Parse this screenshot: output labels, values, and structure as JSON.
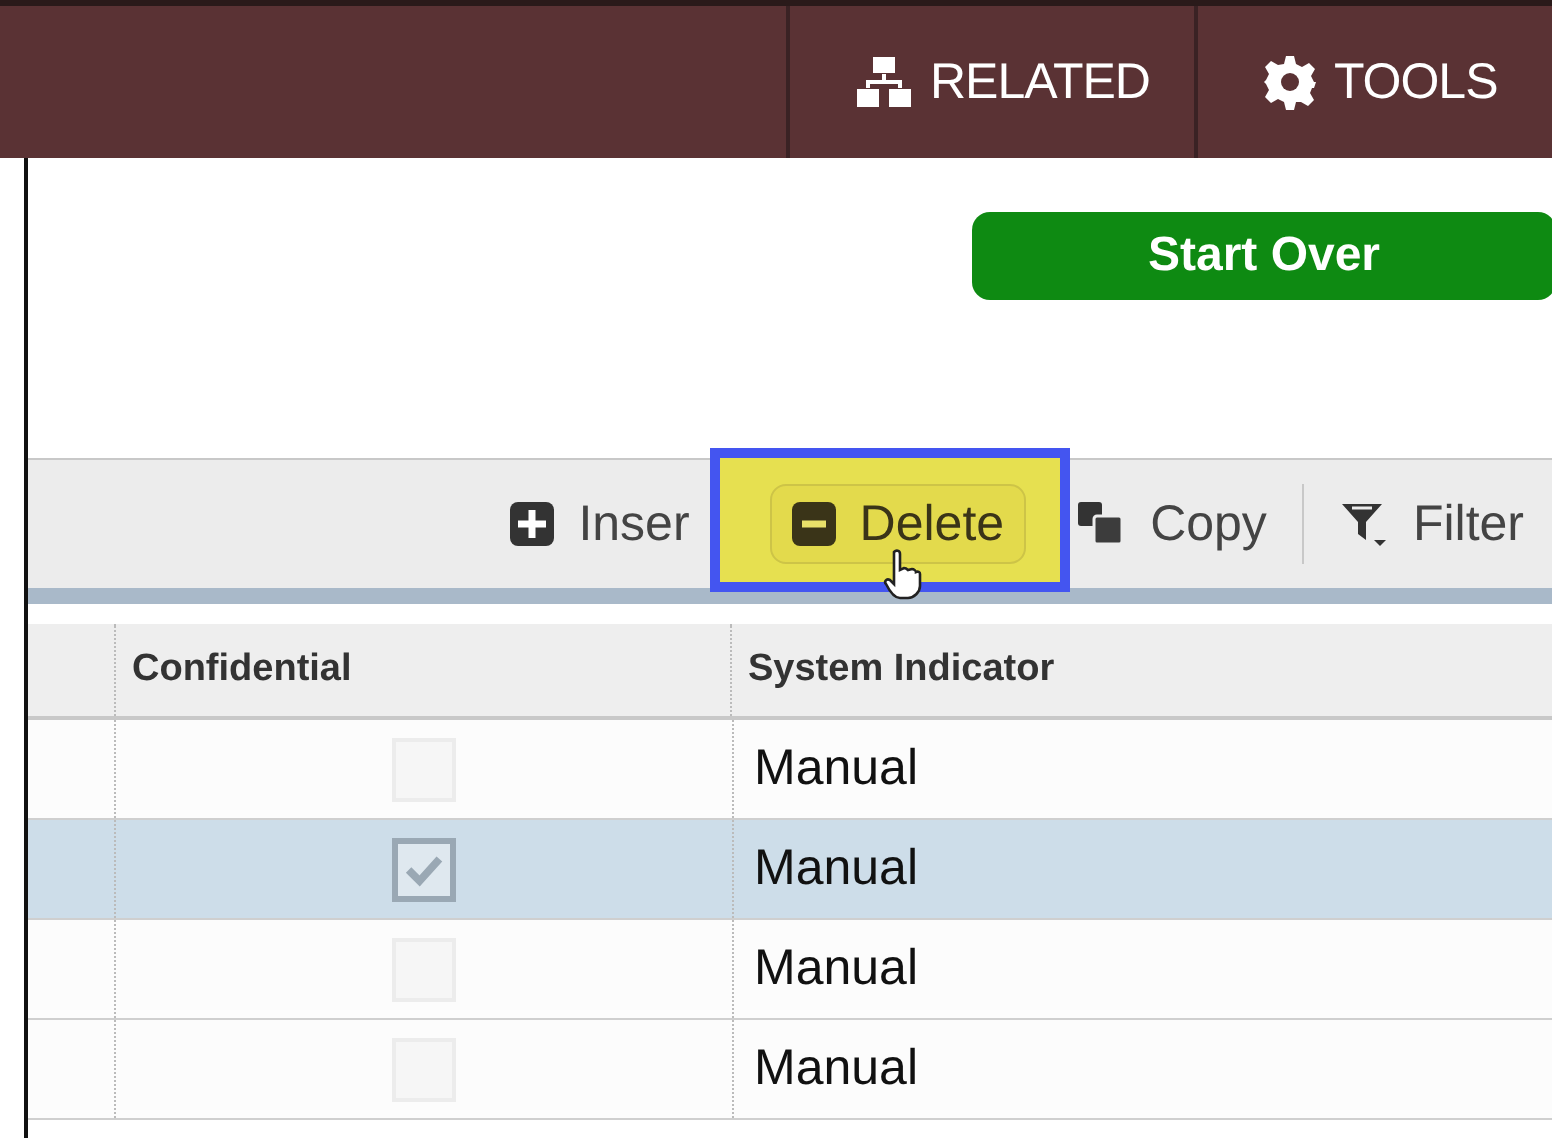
{
  "header": {
    "menus": [
      {
        "label": "RELATED",
        "kind": "related"
      },
      {
        "label": "TOOLS",
        "kind": "gear"
      }
    ]
  },
  "start_over": "Start Over",
  "toolbar": {
    "actions": [
      {
        "label": "Inser",
        "kind": "plus",
        "highlighted": false,
        "divider_after": false
      },
      {
        "label": "Delete",
        "kind": "minus",
        "highlighted": true,
        "divider_after": false
      },
      {
        "label": "Copy",
        "kind": "copy",
        "highlighted": false,
        "divider_after": true
      },
      {
        "label": "Filter",
        "kind": "filter",
        "highlighted": false,
        "divider_after": false
      }
    ]
  },
  "table": {
    "columns": [
      "Confidential",
      "System Indicator"
    ],
    "rows": [
      {
        "confidential": false,
        "system_indicator": "Manual",
        "selected": false
      },
      {
        "confidential": true,
        "system_indicator": "Manual",
        "selected": true
      },
      {
        "confidential": false,
        "system_indicator": "Manual",
        "selected": false
      },
      {
        "confidential": false,
        "system_indicator": "Manual",
        "selected": false
      }
    ]
  }
}
